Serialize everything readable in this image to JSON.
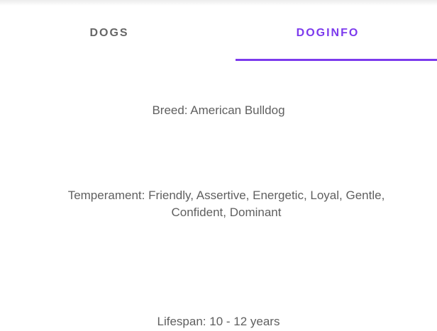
{
  "tabs": [
    {
      "label": "DOGS",
      "active": false
    },
    {
      "label": "DOGINFO",
      "active": true
    }
  ],
  "info": {
    "breed": "Breed: American Bulldog",
    "temperament_line1": "Temperament: Friendly, Assertive, Energetic, Loyal, Gentle,",
    "temperament_line2": "Confident, Dominant",
    "lifespan": "Lifespan: 10 - 12 years"
  },
  "colors": {
    "accent": "#7c3aed",
    "text": "#5f5f5f",
    "inactive_tab": "#666666"
  }
}
